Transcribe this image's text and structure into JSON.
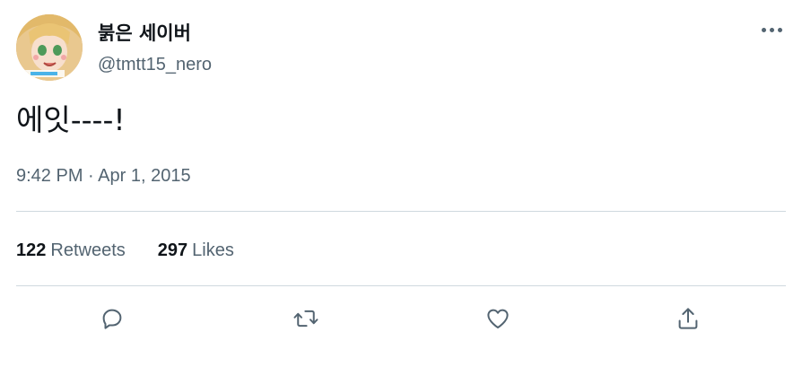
{
  "user": {
    "display_name": "붉은 세이버",
    "handle": "@tmtt15_nero"
  },
  "tweet": {
    "text": "에잇----!",
    "timestamp": "9:42 PM · Apr 1, 2015"
  },
  "stats": {
    "retweets_count": "122",
    "retweets_label": "Retweets",
    "likes_count": "297",
    "likes_label": "Likes"
  },
  "colors": {
    "text_primary": "#0f1419",
    "text_secondary": "#536471",
    "divider": "#cfd9de",
    "icon": "#536471"
  },
  "icons": {
    "more": "more-horizontal-icon",
    "reply": "reply-icon",
    "retweet": "retweet-icon",
    "like": "heart-icon",
    "share": "share-icon"
  }
}
